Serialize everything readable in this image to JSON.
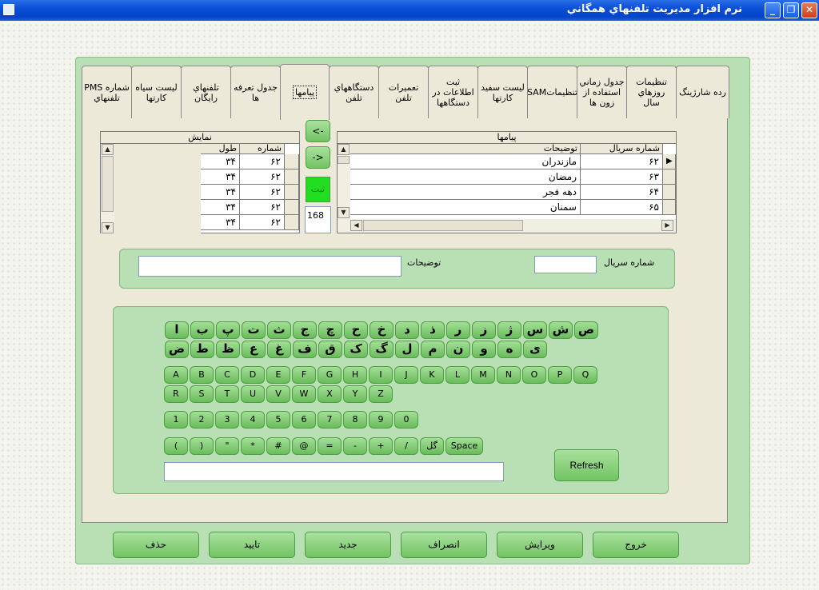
{
  "window": {
    "title": "نرم افزار مديريت تلفنهاي همگاني",
    "minimize": "_",
    "maximize": "❐",
    "close": "✕"
  },
  "tabs": [
    {
      "label": "رده شارژينگ"
    },
    {
      "label": "تنظيمات روزهاي سال"
    },
    {
      "label": "جدول زماني استفاده از زون ها"
    },
    {
      "label": "تنظيماتSAM"
    },
    {
      "label": "ليست سفيد كارتها"
    },
    {
      "label": "ثبت اطلاعات در دستگاهها"
    },
    {
      "label": "تعميرات تلفن"
    },
    {
      "label": "دستگاههاي تلفن"
    },
    {
      "label": "پيامها"
    },
    {
      "label": "جدول تعرفه ها"
    },
    {
      "label": "تلفنهاي رايگان"
    },
    {
      "label": "ليست سياه كارتها"
    },
    {
      "label": "شماره PMS تلفنهاي"
    }
  ],
  "messages_grid": {
    "title": "پيامها",
    "col_serial": "شماره سريال",
    "col_desc": "توضيحات",
    "rows": [
      {
        "serial": "۶۲",
        "desc": "مازندران"
      },
      {
        "serial": "۶۳",
        "desc": "رمضان"
      },
      {
        "serial": "۶۴",
        "desc": "دهه فجر"
      },
      {
        "serial": "۶۵",
        "desc": "سمنان"
      }
    ]
  },
  "display_grid": {
    "title": "نمايش",
    "col_number": "شماره",
    "col_length": "طول",
    "rows": [
      {
        "number": "۶۲",
        "length": "۳۴"
      },
      {
        "number": "۶۲",
        "length": "۳۴"
      },
      {
        "number": "۶۲",
        "length": "۳۴"
      },
      {
        "number": "۶۲",
        "length": "۳۴"
      },
      {
        "number": "۶۲",
        "length": "۳۴"
      }
    ]
  },
  "mid_buttons": {
    "left_arrow": "<-",
    "right_arrow": "->",
    "register": "ثبت",
    "count_value": "168"
  },
  "form": {
    "serial_label": "شماره سريال",
    "desc_label": "توضيحات",
    "serial_value": "",
    "desc_value": ""
  },
  "keyboard": {
    "persian_row1": [
      "ص",
      "ش",
      "س",
      "ژ",
      "ز",
      "ر",
      "ذ",
      "د",
      "خ",
      "ح",
      "چ",
      "ج",
      "ث",
      "ت",
      "پ",
      "ب",
      "ا"
    ],
    "persian_row2": [
      "ی",
      "ه",
      "و",
      "ن",
      "م",
      "ل",
      "گ",
      "ک",
      "ق",
      "ف",
      "غ",
      "ع",
      "ظ",
      "ط",
      "ض"
    ],
    "latin_row1": [
      "A",
      "B",
      "C",
      "D",
      "E",
      "F",
      "G",
      "H",
      "I",
      "J",
      "K",
      "L",
      "M",
      "N",
      "O",
      "P",
      "Q"
    ],
    "latin_row2": [
      "R",
      "S",
      "T",
      "U",
      "V",
      "W",
      "X",
      "Y",
      "Z"
    ],
    "digits": [
      "1",
      "2",
      "3",
      "4",
      "5",
      "6",
      "7",
      "8",
      "9",
      "0"
    ],
    "symbols": [
      "(",
      ")",
      "\"",
      "*",
      "#",
      "@",
      "=",
      "-",
      "+",
      "/",
      "گل"
    ],
    "space": "Space",
    "refresh": "Refresh",
    "output_value": ""
  },
  "actions": [
    {
      "label": "حذف",
      "name": "delete-button"
    },
    {
      "label": "تاييد",
      "name": "confirm-button"
    },
    {
      "label": "جديد",
      "name": "new-button"
    },
    {
      "label": "انصراف",
      "name": "cancel-button"
    },
    {
      "label": "ويرايش",
      "name": "edit-button"
    },
    {
      "label": "خروج",
      "name": "exit-button"
    }
  ],
  "colors": {
    "accent_green": "#78c86a",
    "register_green": "#22dd22",
    "titlebar_blue": "#0a4fd6"
  }
}
